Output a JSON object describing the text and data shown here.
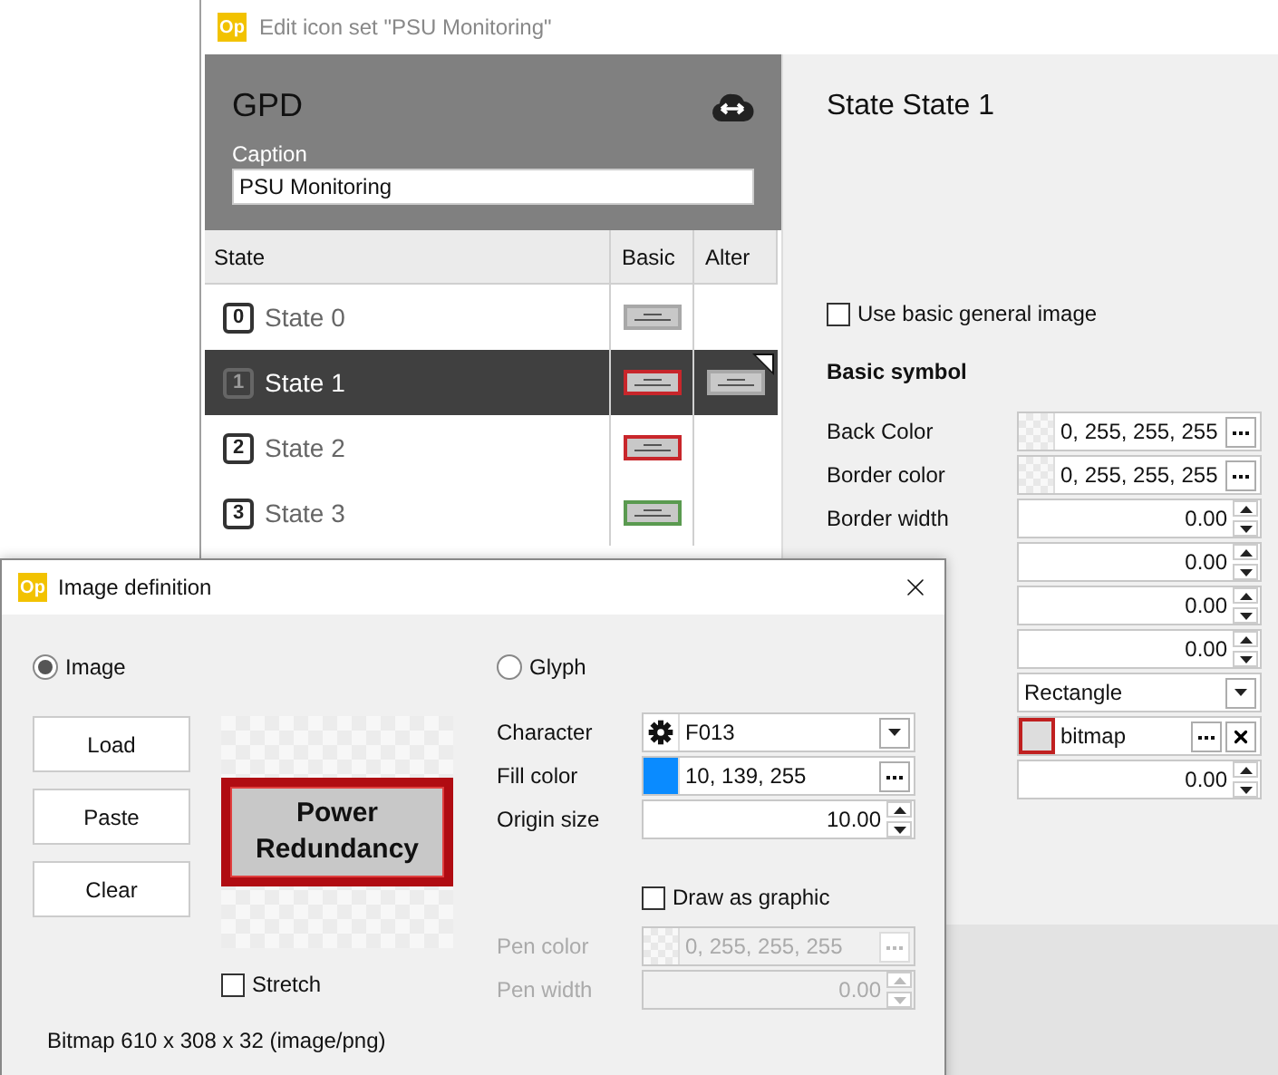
{
  "main_window": {
    "badge": "Op",
    "title": "Edit icon set \"PSU Monitoring\""
  },
  "header": {
    "name": "GPD",
    "caption_label": "Caption",
    "caption_value": "PSU Monitoring"
  },
  "table": {
    "columns": [
      "State",
      "Basic",
      "Alter"
    ],
    "rows": [
      {
        "index": "0",
        "label": "State 0",
        "selected": false,
        "color": "#a8a8a8",
        "has_alter": false
      },
      {
        "index": "1",
        "label": "State 1",
        "selected": true,
        "color": "#c8262b",
        "has_alter": true
      },
      {
        "index": "2",
        "label": "State 2",
        "selected": false,
        "color": "#c8262b",
        "has_alter": false
      },
      {
        "index": "3",
        "label": "State 3",
        "selected": false,
        "color": "#5a9a50",
        "has_alter": false
      }
    ]
  },
  "state_panel": {
    "title": "State State 1",
    "use_basic_image": {
      "label": "Use basic general image",
      "checked": false
    },
    "section": "Basic symbol",
    "properties": [
      {
        "kind": "color",
        "label": "Back Color",
        "value": "0, 255, 255, 255"
      },
      {
        "kind": "color",
        "label": "Border color",
        "value": "0, 255, 255, 255"
      },
      {
        "kind": "number",
        "label": "Border width",
        "value": "0.00"
      },
      {
        "kind": "number",
        "value": "0.00"
      },
      {
        "kind": "number",
        "value": "0.00"
      },
      {
        "kind": "number",
        "value": "0.00"
      },
      {
        "kind": "select",
        "value": "Rectangle"
      },
      {
        "kind": "bitmap",
        "value": "bitmap"
      },
      {
        "kind": "number",
        "value": "0.00"
      }
    ]
  },
  "dialog": {
    "badge": "Op",
    "title": "Image definition",
    "image_option": {
      "label": "Image",
      "selected": true
    },
    "buttons": [
      "Load",
      "Paste",
      "Clear"
    ],
    "preview_lines": [
      "Power",
      "Redundancy"
    ],
    "stretch": {
      "label": "Stretch",
      "checked": false
    },
    "bitmap_info": "Bitmap 610 x 308 x 32 (image/png)",
    "glyph_option": {
      "label": "Glyph",
      "selected": false
    },
    "glyph_fields": [
      {
        "kind": "character",
        "label": "Character",
        "value": "F013",
        "disabled": false
      },
      {
        "kind": "color",
        "label": "Fill color",
        "value": "10, 139, 255",
        "color": "#0a8bff",
        "disabled": false
      },
      {
        "kind": "number",
        "label": "Origin size",
        "value": "10.00",
        "disabled": false
      }
    ],
    "draw_as_graphic": {
      "label": "Draw as graphic",
      "checked": false
    },
    "pen_fields": [
      {
        "kind": "color",
        "label": "Pen color",
        "value": "0, 255, 255, 255",
        "disabled": true
      },
      {
        "kind": "number",
        "label": "Pen width",
        "value": "0.00",
        "disabled": true
      }
    ]
  }
}
